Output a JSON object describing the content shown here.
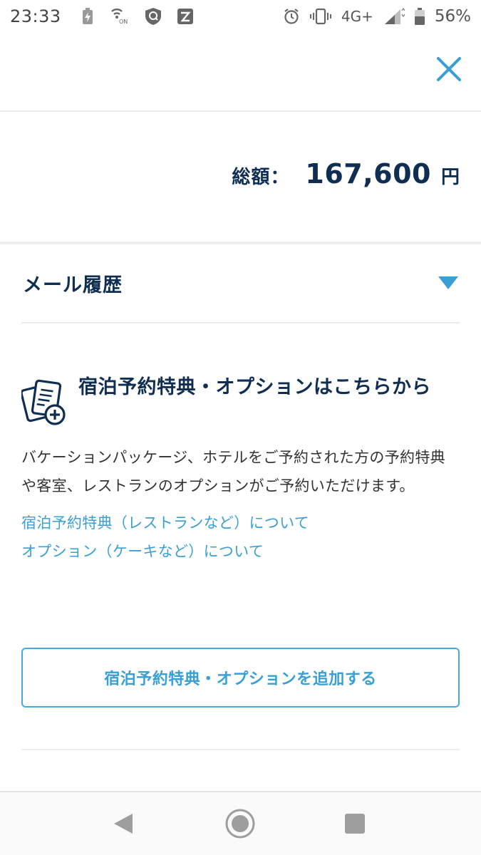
{
  "status_bar": {
    "time": "23:33",
    "network": "4G+",
    "battery_percent": "56%",
    "icons_left": [
      "battery-saver-icon",
      "nfc-icon",
      "vpn-shield-icon",
      "app-icon"
    ],
    "icons_right": [
      "alarm-icon",
      "vibrate-icon",
      "signal-icon",
      "battery-icon"
    ]
  },
  "header": {
    "close_icon": "close-icon"
  },
  "total": {
    "label": "総額：",
    "amount": "167,600",
    "unit": "円"
  },
  "mail_history": {
    "title": "メール履歴",
    "caret_icon": "caret-down-icon",
    "expanded": false
  },
  "options": {
    "icon": "document-add-icon",
    "title": "宿泊予約特典・オプションはこちらから",
    "description": "バケーションパッケージ、ホテルをご予約された方の予約特典や客室、レストランのオプションがご予約いただけます。",
    "links": [
      "宿泊予約特典（レストランなど）について",
      "オプション（ケーキなど）について"
    ],
    "add_button_label": "宿泊予約特典・オプションを追加する"
  },
  "colors": {
    "accent": "#3a9fd4",
    "heading": "#0f2e52"
  },
  "nav_bar": {
    "items": [
      "back-icon",
      "home-icon",
      "recents-icon"
    ]
  }
}
